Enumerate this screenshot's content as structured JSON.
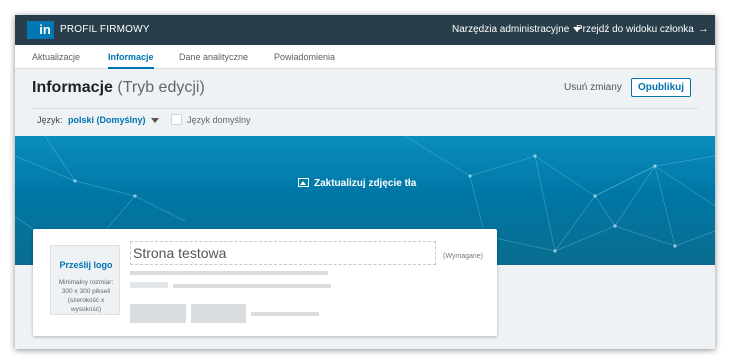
{
  "topbar": {
    "logo_text": "in",
    "title": "PROFIL FIRMOWY",
    "admin_tools": "Narzędzia administracyjne",
    "member_view": "Przejdź do widoku członka"
  },
  "tabs": [
    {
      "label": "Aktualizacje",
      "active": false
    },
    {
      "label": "Informacje",
      "active": true
    },
    {
      "label": "Dane analityczne",
      "active": false
    },
    {
      "label": "Powiadomienia",
      "active": false
    }
  ],
  "header": {
    "title": "Informacje",
    "mode": "(Tryb edycji)",
    "discard": "Usuń zmiany",
    "publish": "Opublikuj"
  },
  "language": {
    "label": "Język:",
    "selected": "polski (Domyślny)",
    "default_checkbox_label": "Język domyślny",
    "default_checked": false
  },
  "banner": {
    "update_background": "Zaktualizuj zdjęcie tła"
  },
  "card": {
    "upload_logo": "Prześlij logo",
    "min_size": "Minimalny rozmiar: 300 x 300 pikseli (szerokość x wysokość)",
    "company_name_value": "Strona testowa",
    "required": "(Wymagane)"
  },
  "colors": {
    "topbar": "#283e4a",
    "accent": "#0073b1",
    "page_bg": "#eef2f5",
    "banner": "#0a7fae"
  },
  "icons": {
    "admin_caret": "chevron-down-icon",
    "member_arrow": "arrow-right-icon",
    "banner_image": "image-icon"
  }
}
